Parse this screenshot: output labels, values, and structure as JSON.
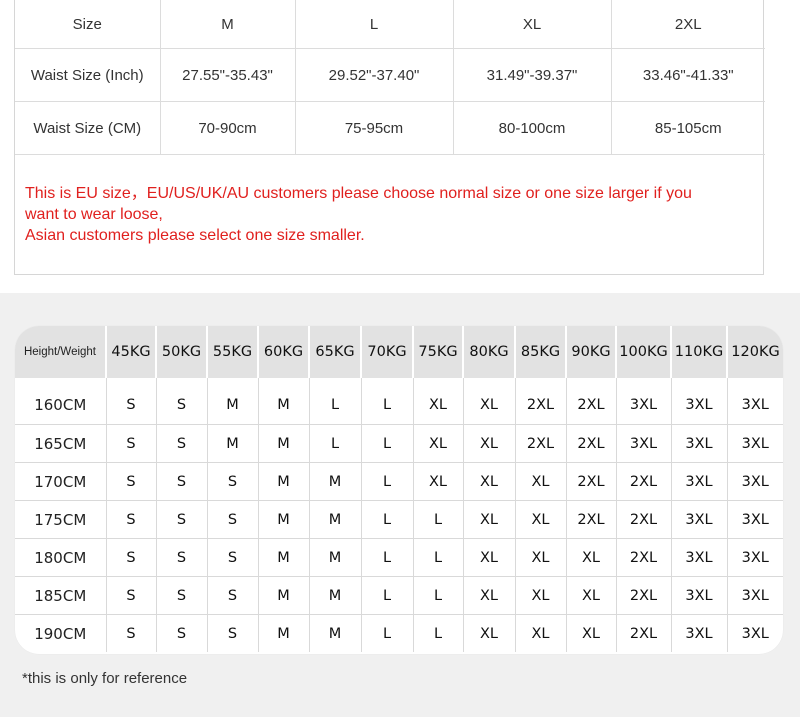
{
  "waist_table": {
    "header": [
      "Size",
      "M",
      "L",
      "XL",
      "2XL"
    ],
    "rows": [
      [
        "Waist Size (Inch)",
        "27.55\"-35.43\"",
        "29.52\"-37.40\"",
        "31.49\"-39.37\"",
        "33.46\"-41.33\""
      ],
      [
        "Waist Size (CM)",
        "70-90cm",
        "75-95cm",
        "80-100cm",
        "85-105cm"
      ]
    ],
    "notice": [
      "This is EU size，EU/US/UK/AU customers please choose normal size or one size larger if you",
      "want to wear loose,",
      "Asian customers please select one size smaller."
    ],
    "notice_color": "#e0201e"
  },
  "size_chart": {
    "corner_label": "Height/Weight",
    "weights": [
      "45KG",
      "50KG",
      "55KG",
      "60KG",
      "65KG",
      "70KG",
      "75KG",
      "80KG",
      "85KG",
      "90KG",
      "100KG",
      "110KG",
      "120KG"
    ],
    "rows": [
      {
        "height": "160CM",
        "sizes": [
          "S",
          "S",
          "M",
          "M",
          "L",
          "L",
          "XL",
          "XL",
          "2XL",
          "2XL",
          "3XL",
          "3XL",
          "3XL"
        ]
      },
      {
        "height": "165CM",
        "sizes": [
          "S",
          "S",
          "M",
          "M",
          "L",
          "L",
          "XL",
          "XL",
          "2XL",
          "2XL",
          "3XL",
          "3XL",
          "3XL"
        ]
      },
      {
        "height": "170CM",
        "sizes": [
          "S",
          "S",
          "S",
          "M",
          "M",
          "L",
          "XL",
          "XL",
          "XL",
          "2XL",
          "2XL",
          "3XL",
          "3XL"
        ]
      },
      {
        "height": "175CM",
        "sizes": [
          "S",
          "S",
          "S",
          "M",
          "M",
          "L",
          "L",
          "XL",
          "XL",
          "2XL",
          "2XL",
          "3XL",
          "3XL"
        ]
      },
      {
        "height": "180CM",
        "sizes": [
          "S",
          "S",
          "S",
          "M",
          "M",
          "L",
          "L",
          "XL",
          "XL",
          "XL",
          "2XL",
          "3XL",
          "3XL"
        ]
      },
      {
        "height": "185CM",
        "sizes": [
          "S",
          "S",
          "S",
          "M",
          "M",
          "L",
          "L",
          "XL",
          "XL",
          "XL",
          "2XL",
          "3XL",
          "3XL"
        ]
      },
      {
        "height": "190CM",
        "sizes": [
          "S",
          "S",
          "S",
          "M",
          "M",
          "L",
          "L",
          "XL",
          "XL",
          "XL",
          "2XL",
          "3XL",
          "3XL"
        ]
      }
    ],
    "footnote": "*this is only for reference",
    "header_bg": "#e2e2e2",
    "background": "#f0f0f0"
  }
}
